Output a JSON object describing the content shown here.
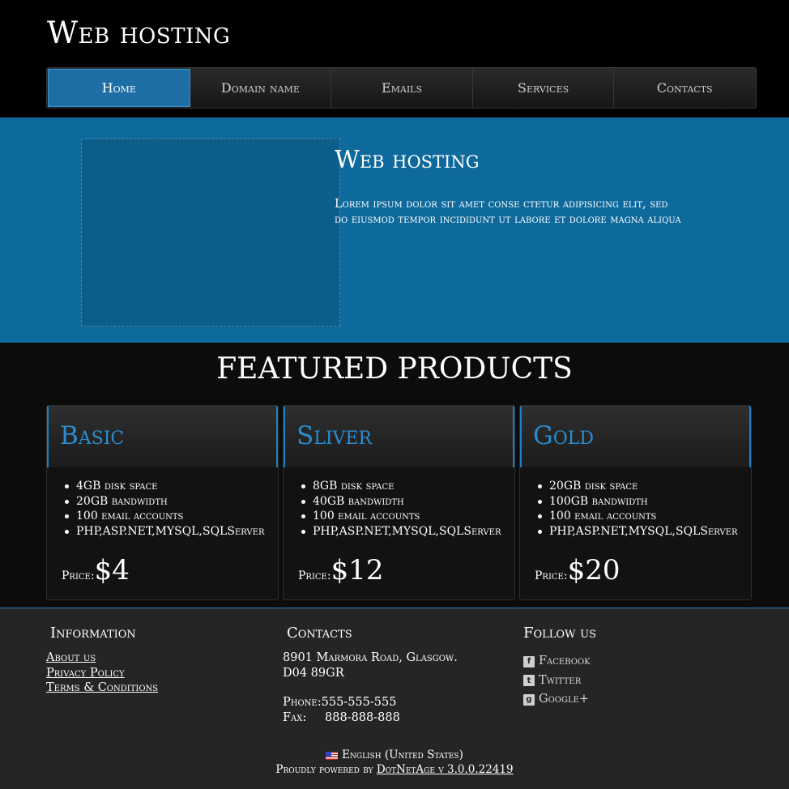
{
  "site": {
    "title": "Web hosting"
  },
  "nav": {
    "items": [
      {
        "label": "Home",
        "active": true
      },
      {
        "label": "Domain name"
      },
      {
        "label": "Emails"
      },
      {
        "label": "Services"
      },
      {
        "label": "Contacts"
      }
    ]
  },
  "hero": {
    "title": "Web hosting",
    "text": "Lorem ipsum dolor sit amet conse ctetur adipisicing elit, sed do eiusmod tempor incididunt ut labore et dolore magna aliqua"
  },
  "featured": {
    "title": "FEATURED PRODUCTS",
    "products": [
      {
        "name": "Basic",
        "features": [
          "4GB disk space",
          "20GB bandwidth",
          "100 email accounts",
          "PHP,ASP.NET,MYSQL,SQLServer"
        ],
        "price_label": "Price:",
        "price": "$4"
      },
      {
        "name": "Sliver",
        "features": [
          "8GB disk space",
          "40GB bandwidth",
          "100 email accounts",
          "PHP,ASP.NET,MYSQL,SQLServer"
        ],
        "price_label": "Price:",
        "price": "$12"
      },
      {
        "name": "Gold",
        "features": [
          "20GB disk space",
          "100GB bandwidth",
          "100 email accounts",
          "PHP,ASP.NET,MYSQL,SQLServer"
        ],
        "price_label": "Price:",
        "price": "$20"
      }
    ]
  },
  "footer": {
    "information": {
      "heading": "Information",
      "links": [
        "About us",
        "Privacy Policy",
        "Terms & Conditions"
      ]
    },
    "contacts": {
      "heading": "Contacts",
      "address_line1": "8901 Marmora Road, Glasgow.",
      "address_line2": "D04 89GR",
      "phone_label": "Phone:",
      "phone": "555-555-555",
      "fax_label": "Fax:",
      "fax": "888-888-888"
    },
    "follow": {
      "heading": "Follow us",
      "items": [
        {
          "label": "Facebook",
          "icon": "facebook-icon"
        },
        {
          "label": "Twitter",
          "icon": "twitter-icon"
        },
        {
          "label": "Google+",
          "icon": "google-plus-icon"
        }
      ]
    },
    "language": "English (United States)",
    "powered_prefix": "Proudly powered by",
    "powered_link": "DotNetAge v 3.0.0.22419"
  },
  "colors": {
    "accent": "#1a82c4",
    "hero_bg": "#0e6a9c",
    "footer_bg": "#252525"
  }
}
